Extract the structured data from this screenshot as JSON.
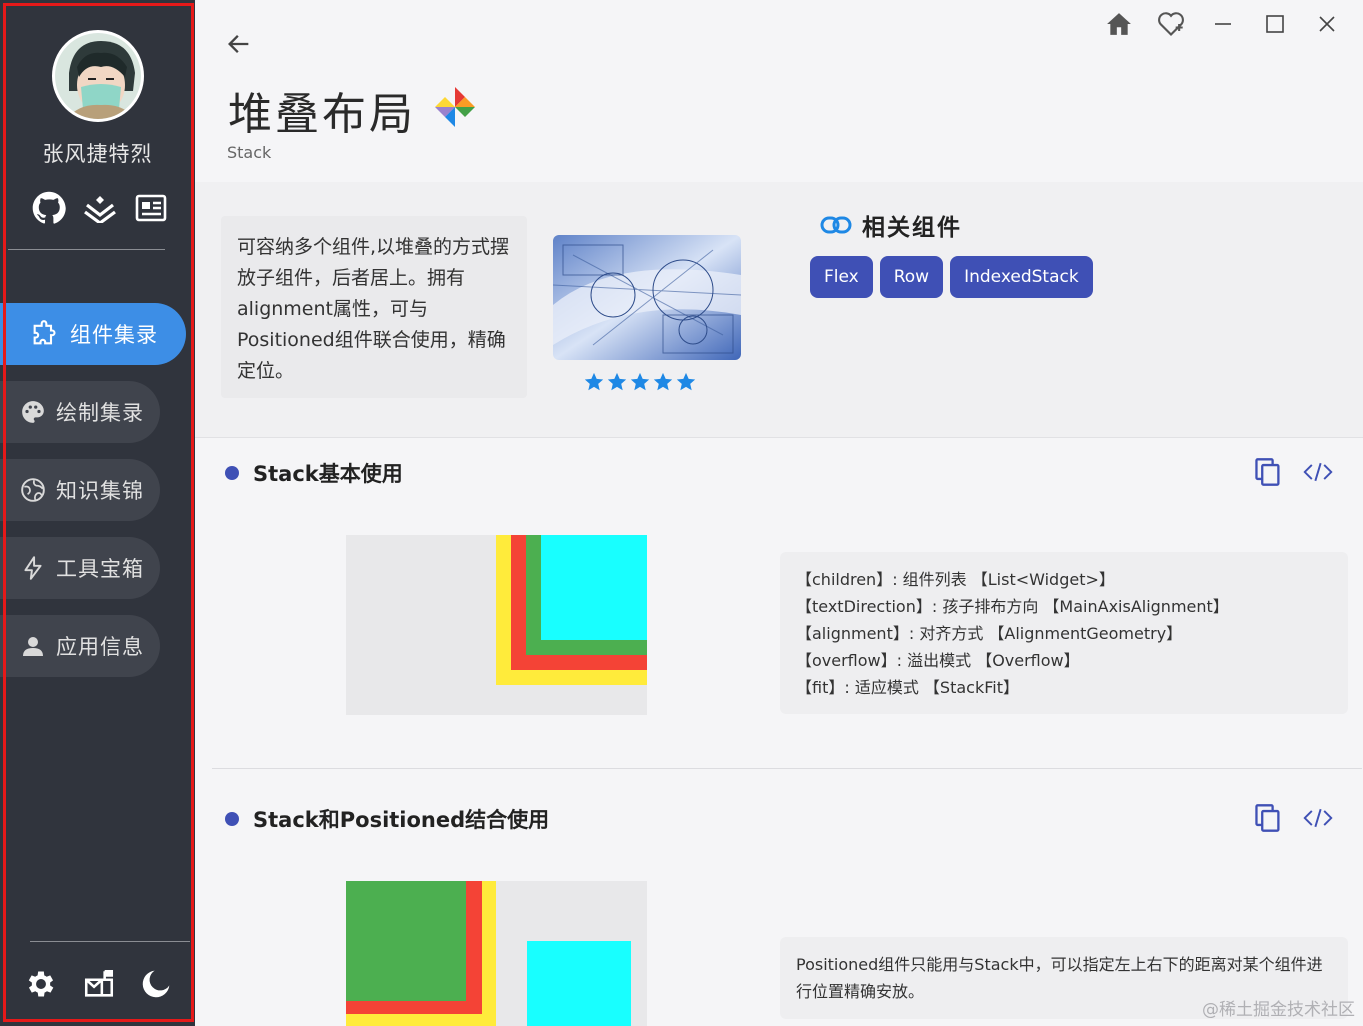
{
  "user": {
    "name": "张风捷特烈"
  },
  "social": [
    {
      "icon": "github-icon"
    },
    {
      "icon": "juejin-icon"
    },
    {
      "icon": "card-icon"
    }
  ],
  "nav": {
    "items": [
      {
        "label": "组件集录",
        "icon": "puzzle-icon",
        "active": true
      },
      {
        "label": "绘制集录",
        "icon": "palette-icon",
        "active": false
      },
      {
        "label": "知识集锦",
        "icon": "globe-icon",
        "active": false
      },
      {
        "label": "工具宝箱",
        "icon": "lightning-icon",
        "active": false
      },
      {
        "label": "应用信息",
        "icon": "person-icon",
        "active": false
      }
    ]
  },
  "bottom_icons": [
    "settings-icon",
    "mailbox-icon",
    "moon-icon"
  ],
  "window_controls": [
    "home-icon",
    "favorite-icon",
    "minimize-icon",
    "maximize-icon",
    "close-icon"
  ],
  "page": {
    "title": "堆叠布局",
    "subtitle": "Stack",
    "description": "可容纳多个组件,以堆叠的方式摆放子组件，后者居上。拥有alignment属性，可与Positioned组件联合使用，精确定位。",
    "rating": 5,
    "related_title": "相关组件",
    "related": [
      "Flex",
      "Row",
      "IndexedStack"
    ]
  },
  "sections": [
    {
      "title": "Stack基本使用",
      "props": [
        "【children】: 组件列表   【List<Widget>】",
        "【textDirection】: 孩子排布方向   【MainAxisAlignment】",
        "【alignment】: 对齐方式   【AlignmentGeometry】",
        "【overflow】: 溢出模式   【Overflow】",
        "【fit】: 适应模式   【StackFit】"
      ]
    },
    {
      "title": "Stack和Positioned结合使用",
      "props": [
        "Positioned组件只能用与Stack中，可以指定左上右下的距离对某个组件进行位置精确安放。"
      ]
    }
  ],
  "colors": {
    "sidebar": "#30343d",
    "active": "#3d8ee6",
    "chip": "#3f50b5",
    "yellow": "#ffeb3b",
    "red": "#f44336",
    "green": "#4caf50",
    "cyan": "#18ffff"
  },
  "watermark": "@稀土掘金技术社区"
}
